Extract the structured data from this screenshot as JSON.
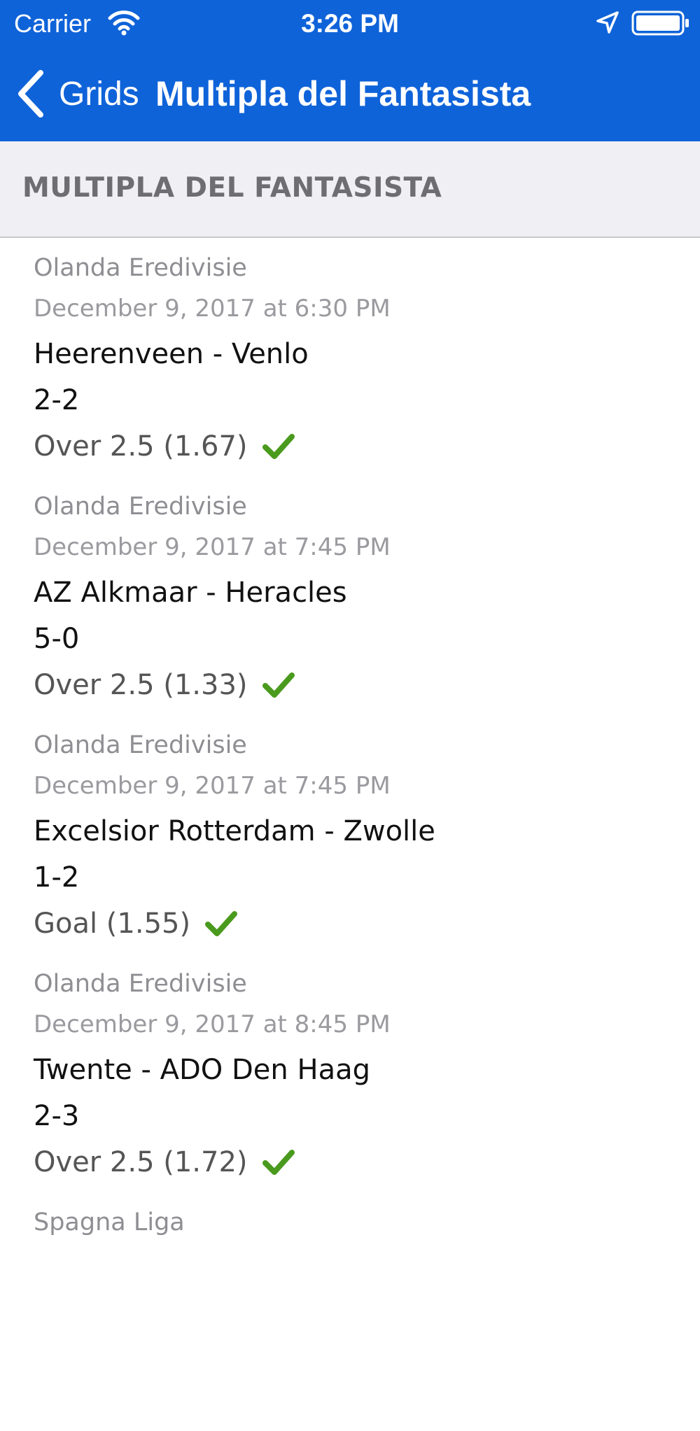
{
  "status_bar": {
    "carrier": "Carrier",
    "time": "3:26 PM"
  },
  "nav": {
    "back_label": "Grids",
    "title": "Multipla del Fantasista"
  },
  "section": {
    "title": "MULTIPLA DEL FANTASISTA"
  },
  "bets": [
    {
      "league": "Olanda Eredivisie",
      "datetime": "December 9, 2017 at 6:30 PM",
      "match": "Heerenveen - Venlo",
      "score": "2-2",
      "pick": "Over 2.5 (1.67)"
    },
    {
      "league": "Olanda Eredivisie",
      "datetime": "December 9, 2017 at 7:45 PM",
      "match": "AZ Alkmaar - Heracles",
      "score": "5-0",
      "pick": "Over 2.5 (1.33)"
    },
    {
      "league": "Olanda Eredivisie",
      "datetime": "December 9, 2017 at 7:45 PM",
      "match": "Excelsior Rotterdam - Zwolle",
      "score": "1-2",
      "pick": "Goal (1.55)"
    },
    {
      "league": "Olanda Eredivisie",
      "datetime": "December 9, 2017 at 8:45 PM",
      "match": "Twente - ADO Den Haag",
      "score": "2-3",
      "pick": "Over 2.5 (1.72)"
    },
    {
      "league": "Spagna Liga"
    }
  ],
  "colors": {
    "header_background": "#0f63d9",
    "section_background": "#efeff4",
    "check_green": "#4a9a1e"
  }
}
